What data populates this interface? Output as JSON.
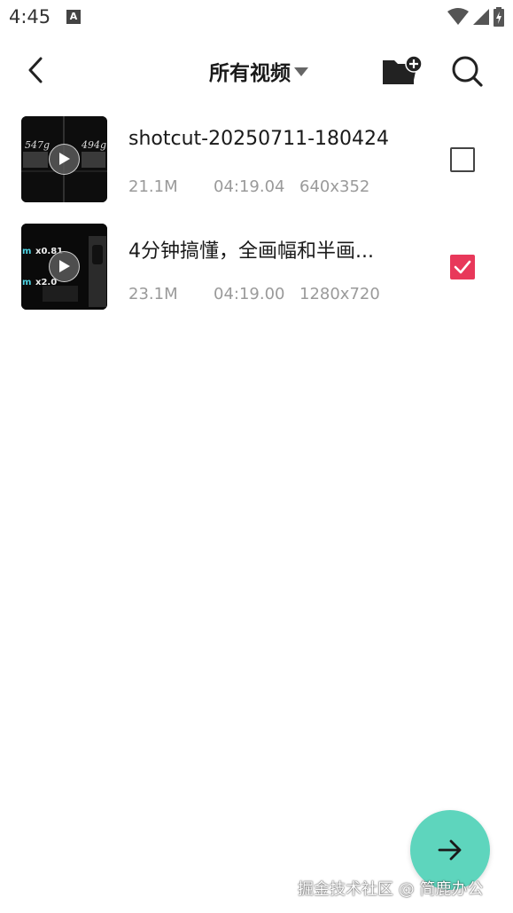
{
  "status_bar": {
    "time": "4:45",
    "notification_icon": "A",
    "icons": [
      "wifi-icon",
      "signal-icon",
      "battery-charging-icon"
    ]
  },
  "toolbar": {
    "title": "所有视频",
    "back_icon": "chevron-left-icon",
    "dropdown_icon": "caret-down-icon",
    "folder_icon": "folder-add-icon",
    "search_icon": "search-icon"
  },
  "videos": [
    {
      "name": "shotcut-20250711-180424",
      "size": "21.1M",
      "duration": "04:19.04",
      "resolution": "640x352",
      "selected": false,
      "thumb_text": [
        "547g",
        "494g"
      ]
    },
    {
      "name": "4分钟搞懂，全画幅和半画...",
      "size": "23.1M",
      "duration": "04:19.00",
      "resolution": "1280x720",
      "selected": true,
      "thumb_text": [
        "x0.81",
        "x2.0",
        "m",
        "m"
      ]
    }
  ],
  "fab": {
    "icon": "arrow-right-icon"
  },
  "watermark": "掘金技术社区 @ 简鹿办公",
  "colors": {
    "accent_check": "#e8385a",
    "fab": "#5ed5bd",
    "meta_text": "#9a9a9a"
  }
}
